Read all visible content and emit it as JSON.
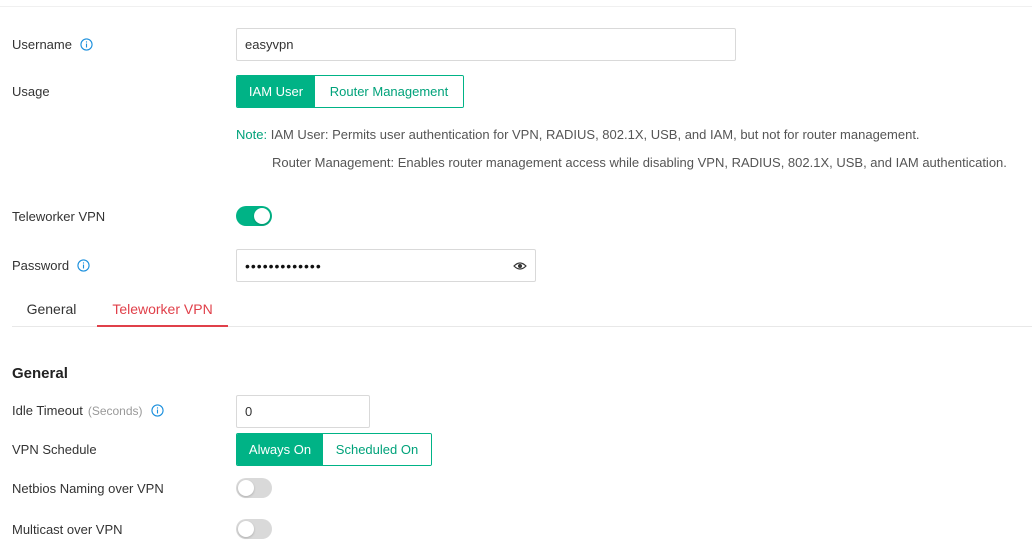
{
  "form": {
    "username": {
      "label": "Username",
      "value": "easyvpn"
    },
    "usage": {
      "label": "Usage",
      "options": [
        "IAM User",
        "Router Management"
      ],
      "selected": "IAM User"
    },
    "note": {
      "key": "Note:",
      "line1": "IAM User: Permits user authentication for VPN, RADIUS, 802.1X, USB, and IAM, but not for router management.",
      "line2": "Router Management: Enables router management access while disabling VPN, RADIUS, 802.1X, USB, and IAM authentication."
    },
    "teleworker_vpn": {
      "label": "Teleworker VPN",
      "enabled": true
    },
    "password": {
      "label": "Password",
      "masked_value": "•••••••••••••"
    }
  },
  "tabs": [
    {
      "label": "General",
      "active": false
    },
    {
      "label": "Teleworker VPN",
      "active": true
    }
  ],
  "general": {
    "title": "General",
    "idle_timeout": {
      "label": "Idle Timeout",
      "unit": "(Seconds)",
      "value": "0"
    },
    "vpn_schedule": {
      "label": "VPN Schedule",
      "options": [
        "Always On",
        "Scheduled On"
      ],
      "selected": "Always On"
    },
    "netbios": {
      "label": "Netbios Naming over VPN",
      "enabled": false
    },
    "multicast": {
      "label": "Multicast over VPN",
      "enabled": false
    }
  },
  "colors": {
    "accent": "#00b386",
    "tab_active": "#e0404a",
    "info_icon": "#1a8fdd"
  },
  "icons": [
    "info-icon",
    "eye-icon"
  ]
}
